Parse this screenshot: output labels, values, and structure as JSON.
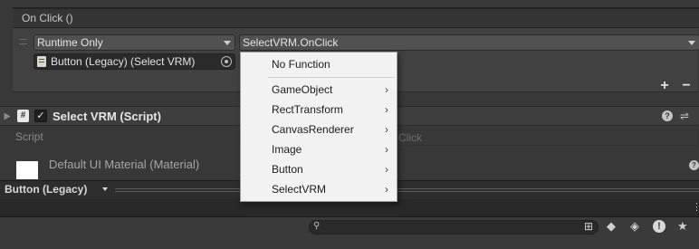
{
  "event": {
    "title": "On Click ()",
    "runtime_label": "Runtime Only",
    "method_label": "SelectVRM.OnClick",
    "object_label": "Button (Legacy) (Select VRM)",
    "add_label": "+",
    "remove_label": "−"
  },
  "component": {
    "title": "Select VRM (Script)",
    "checkbox_mark": "✓",
    "icon_glyph": "#",
    "script_label": "Script",
    "script_ghost": "Click"
  },
  "material": {
    "label": "Default UI Material (Material)"
  },
  "bottom": {
    "title": "Button (Legacy)"
  },
  "menu": {
    "no_function": "No Function",
    "items": [
      {
        "label": "GameObject",
        "sub": "›"
      },
      {
        "label": "RectTransform",
        "sub": "›"
      },
      {
        "label": "CanvasRenderer",
        "sub": "›"
      },
      {
        "label": "Image",
        "sub": "›"
      },
      {
        "label": "Button",
        "sub": "›"
      },
      {
        "label": "SelectVRM",
        "sub": "›"
      }
    ]
  },
  "icons": {
    "help": "?",
    "settings": "⇌",
    "search": "⚲",
    "tb_warn": "!",
    "tb_star": "★"
  }
}
